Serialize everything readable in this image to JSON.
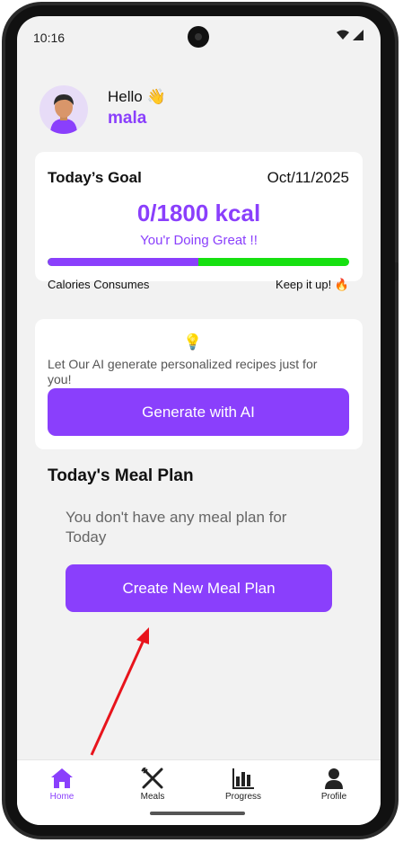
{
  "status_bar": {
    "time": "10:16"
  },
  "header": {
    "greeting": "Hello 👋",
    "username": "mala"
  },
  "goal": {
    "title": "Today’s Goal",
    "date": "Oct/11/2025",
    "kcal": "0/1800 kcal",
    "motivation": "You'r Doing Great !!",
    "progress_fraction": 0.5,
    "left_label": "Calories Consumes",
    "right_label": "Keep it up! 🔥"
  },
  "ai": {
    "icon": "💡",
    "text": "Let Our AI generate personalized recipes just for you!",
    "button_label": "Generate with AI"
  },
  "meal_plan": {
    "title": "Today's Meal Plan",
    "empty_text": "You don't have any meal plan for Today",
    "button_label": "Create New Meal Plan"
  },
  "nav": {
    "items": [
      {
        "label": "Home",
        "icon": "home-icon",
        "active": true
      },
      {
        "label": "Meals",
        "icon": "utensils-icon",
        "active": false
      },
      {
        "label": "Progress",
        "icon": "bar-chart-icon",
        "active": false
      },
      {
        "label": "Profile",
        "icon": "user-icon",
        "active": false
      }
    ]
  },
  "colors": {
    "accent": "#8a3ffc",
    "progress_remaining": "#16e010",
    "annotation_arrow": "#e8141c"
  }
}
